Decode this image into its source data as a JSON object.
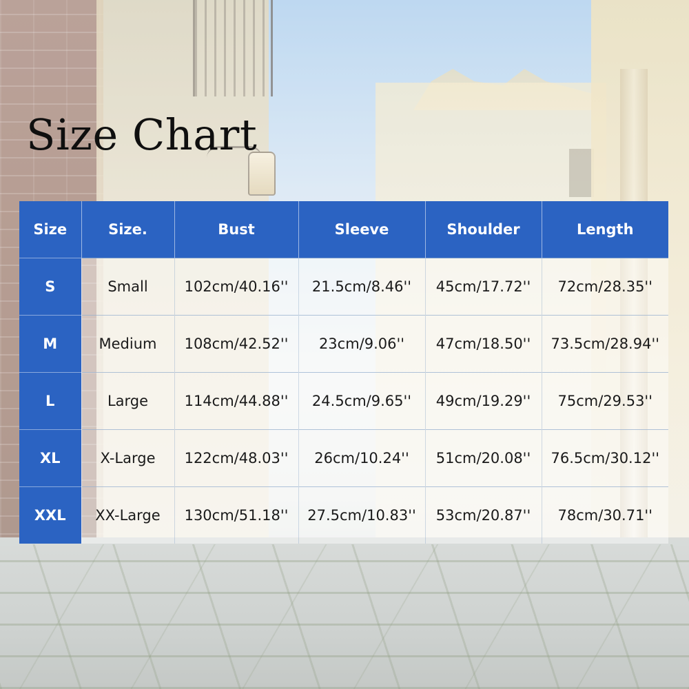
{
  "title": "Size Chart",
  "colors": {
    "header_blue": "#2b63c2",
    "header_text": "#ffffff",
    "cell_text": "#1a1a1a"
  },
  "table": {
    "headers": [
      "Size",
      "Size.",
      "Bust",
      "Sleeve",
      "Shoulder",
      "Length"
    ],
    "rows": [
      [
        "S",
        "Small",
        "102cm/40.16''",
        "21.5cm/8.46''",
        "45cm/17.72''",
        "72cm/28.35''"
      ],
      [
        "M",
        "Medium",
        "108cm/42.52''",
        "23cm/9.06''",
        "47cm/18.50''",
        "73.5cm/28.94''"
      ],
      [
        "L",
        "Large",
        "114cm/44.88''",
        "24.5cm/9.65''",
        "49cm/19.29''",
        "75cm/29.53''"
      ],
      [
        "XL",
        "X-Large",
        "122cm/48.03''",
        "26cm/10.24''",
        "51cm/20.08''",
        "76.5cm/30.12''"
      ],
      [
        "XXL",
        "XX-Large",
        "130cm/51.18''",
        "27.5cm/10.83''",
        "53cm/20.87''",
        "78cm/30.71''"
      ]
    ]
  }
}
